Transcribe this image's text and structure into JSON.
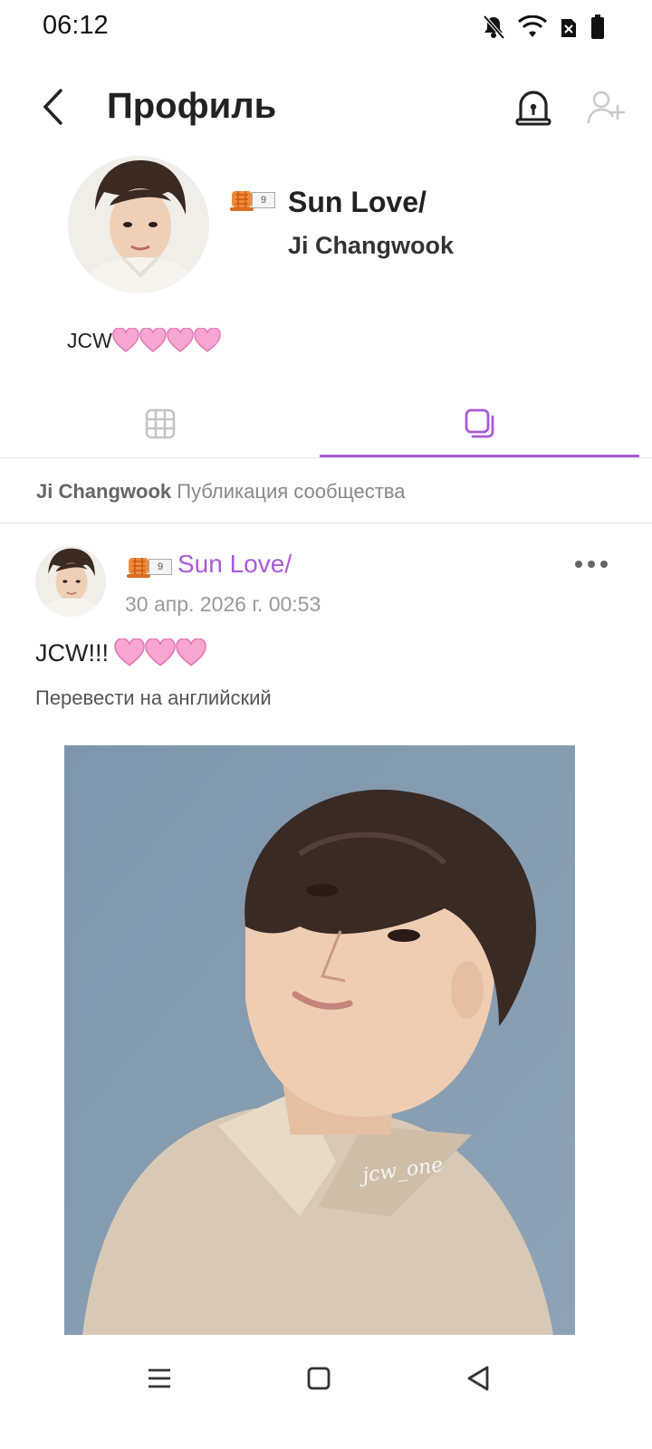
{
  "status_bar": {
    "time": "06:12"
  },
  "header": {
    "title": "Профиль"
  },
  "profile": {
    "level": "9",
    "name": "Sun Love/",
    "community": "Ji Changwook",
    "bio": "JCW"
  },
  "tabs": [
    {
      "name": "grid",
      "active": false
    },
    {
      "name": "posts",
      "active": true
    }
  ],
  "community_label": {
    "community": "Ji Changwook",
    "type": "Публикация сообщества"
  },
  "post": {
    "level": "9",
    "author": "Sun Love/",
    "date": "30 апр. 2026 г. 00:53",
    "text": "JCW!!!",
    "translate": "Перевести на английский",
    "watermark": "jcw_one"
  },
  "colors": {
    "accent": "#a95ad6",
    "heart": "#f58cc8"
  }
}
